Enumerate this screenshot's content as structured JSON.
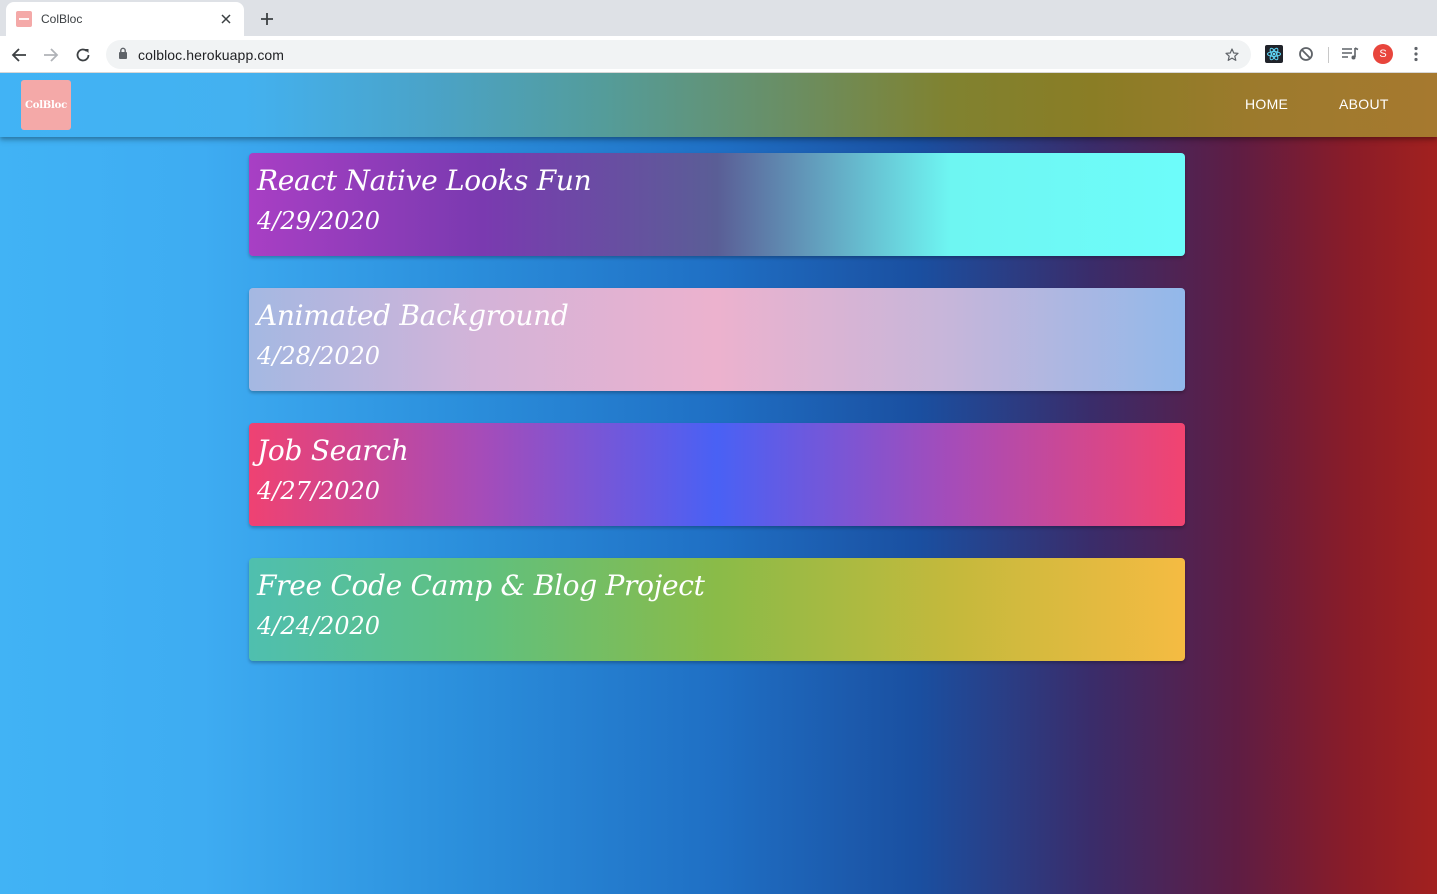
{
  "browser": {
    "tab_title": "ColBloc",
    "url": "colbloc.herokuapp.com",
    "profile_initial": "S",
    "profile_color": "#e8453c"
  },
  "app": {
    "logo_text": "ColBloc",
    "logo_color": "#f4a9a8",
    "nav": {
      "home": "HOME",
      "about": "ABOUT"
    }
  },
  "posts": [
    {
      "title": "React Native Looks Fun",
      "date": "4/29/2020",
      "gradient": [
        "#a83fc4",
        "#7a3ab0",
        "#5a5e96",
        "#6ef6f2",
        "#6dfcfa"
      ]
    },
    {
      "title": "Animated Background",
      "date": "4/28/2020",
      "gradient": [
        "#a4b8e2",
        "#d4b3d8",
        "#ecb2ce",
        "#c6b6da",
        "#92b8ea"
      ]
    },
    {
      "title": "Job Search",
      "date": "4/27/2020",
      "gradient": [
        "#ef4272",
        "#a54cb9",
        "#4961f5",
        "#a54cb9",
        "#f24470"
      ]
    },
    {
      "title": "Free Code Camp & Blog Project",
      "date": "4/24/2020",
      "gradient": [
        "#4fbfaf",
        "#60c07e",
        "#8abb48",
        "#c4b93c",
        "#f5bb42"
      ]
    }
  ]
}
